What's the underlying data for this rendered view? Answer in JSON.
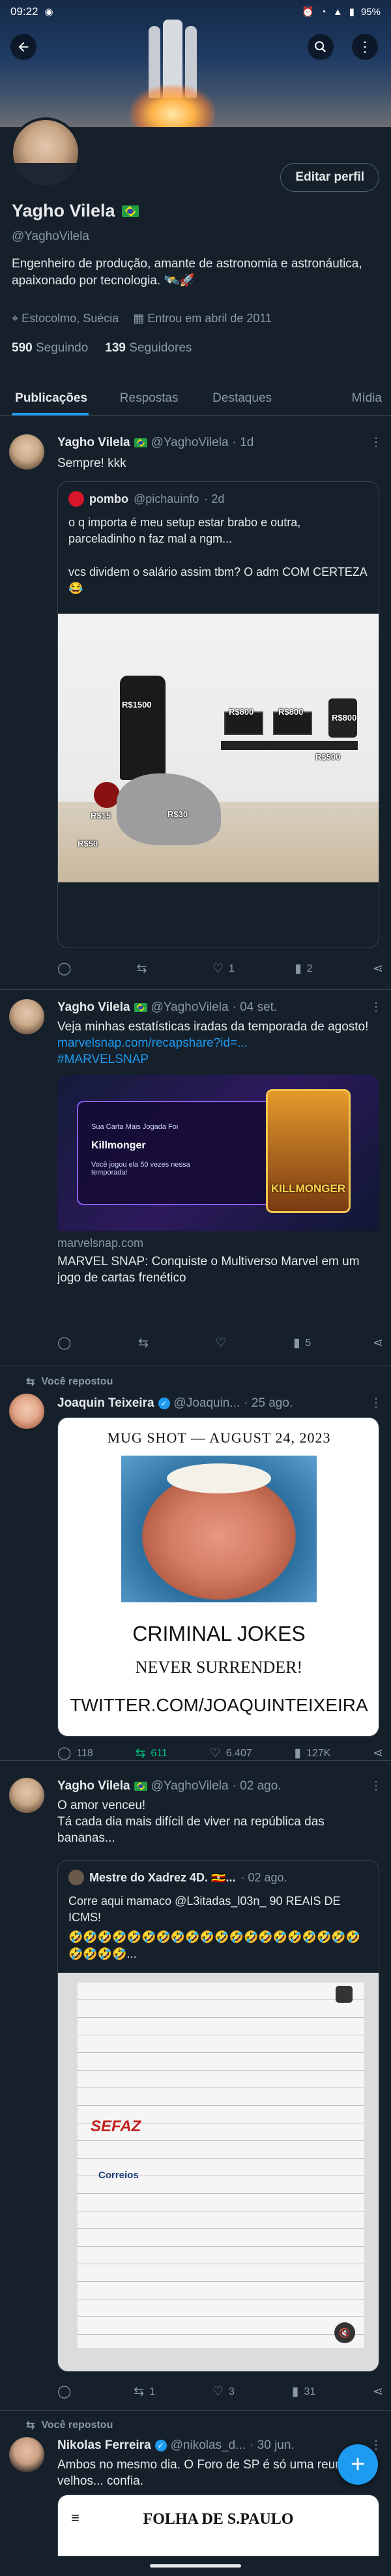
{
  "status_bar": {
    "time": "09:22",
    "battery": "95%"
  },
  "profile": {
    "name": "Yagho Vilela",
    "handle": "@YaghoVilela",
    "bio": "Engenheiro de produção, amante de astronomia e astronáutica, apaixonado por tecnologia. 🛰️🚀",
    "location": "Estocolmo, Suécia",
    "joined": "Entrou em abril de 2011",
    "following_count": "590",
    "following_label": "Seguindo",
    "followers_count": "139",
    "followers_label": "Seguidores",
    "edit_label": "Editar perfil"
  },
  "tabs": [
    "Publicações",
    "Respostas",
    "Destaques",
    "Mídia"
  ],
  "tweets": [
    {
      "name": "Yagho Vilela",
      "handle": "@YaghoVilela",
      "time": "· 1d",
      "text": "Sempre! kkk",
      "quote": {
        "name": "pombo",
        "handle": "@pichauinfo",
        "time": "· 2d",
        "text1": "o q importa é meu setup estar brabo e outra, parceladinho n faz mal a ngm...",
        "text2": "vcs dividem o salário assim tbm? O adm COM CERTEZA 😂",
        "tags": [
          "R$1500",
          "R$800",
          "R$800",
          "R$800",
          "R$500",
          "R$15",
          "R$30",
          "R$50"
        ]
      },
      "stats": {
        "replies": "",
        "retweets": "",
        "likes": "1",
        "views": "2"
      }
    },
    {
      "name": "Yagho Vilela",
      "handle": "@YaghoVilela",
      "time": "· 04 set.",
      "text": "Veja minhas estatísticas iradas da temporada de agosto!",
      "link": "marvelsnap.com/recapshare?id=...",
      "hashtag": "#MARVELSNAP",
      "card": {
        "domain": "marvelsnap.com",
        "title": "MARVEL SNAP: Conquiste o Multiverso Marvel em um jogo de cartas frenético",
        "img_line1": "Sua Carta Mais Jogada Foi",
        "img_line2": "Killmonger",
        "img_line3": "Você jogou ela 50 vezes nessa temporada!",
        "img_card_name": "KILLMONGER"
      },
      "stats": {
        "replies": "",
        "retweets": "",
        "likes": "",
        "views": "5"
      }
    },
    {
      "repost_label": "Você repostou",
      "name": "Joaquin Teixeira",
      "handle": "@Joaquin...",
      "time": "· 25 ago.",
      "mug": {
        "header": "MUG SHOT — AUGUST 24, 2023",
        "line1": "CRIMINAL JOKES",
        "line2": "NEVER SURRENDER!",
        "line3": "TWITTER.COM/JOAQUINTEIXEIRA"
      },
      "stats": {
        "replies": "118",
        "retweets": "611",
        "likes": "6.407",
        "views": "127K"
      }
    },
    {
      "name": "Yagho Vilela",
      "handle": "@YaghoVilela",
      "time": "· 02 ago.",
      "text": "O amor venceu!\nTá cada dia mais difícil de viver na república das bananas...",
      "quote": {
        "name": "Mestre do Xadrez 4D. 🇺🇬...",
        "time": "· 02 ago.",
        "text": "Corre aqui mamaco @L3itadas_l03n_ 90 REAIS DE ICMS!",
        "emoji_line": "🤣🤣🤣🤣🤣🤣🤣🤣🤣🤣🤣🤣🤣🤣🤣🤣🤣🤣🤣🤣🤣🤣🤣🤣...",
        "doc_brand1": "SEFAZ",
        "doc_brand2": "Correios"
      },
      "stats": {
        "replies": "",
        "retweets": "1",
        "likes": "3",
        "views": "31"
      }
    },
    {
      "repost_label": "Você repostou",
      "name": "Nikolas Ferreira",
      "handle": "@nikolas_d...",
      "time": "· 30 jun.",
      "text": "Ambos no mesmo dia. O Foro de SP é só uma reunião de velhos... confia.",
      "card_title": "FOLHA DE S.PAULO"
    }
  ],
  "colors": {
    "background": "#15202b",
    "accent": "#1d9bf0",
    "muted": "#8b98a5",
    "retweet": "#00ba7c"
  }
}
